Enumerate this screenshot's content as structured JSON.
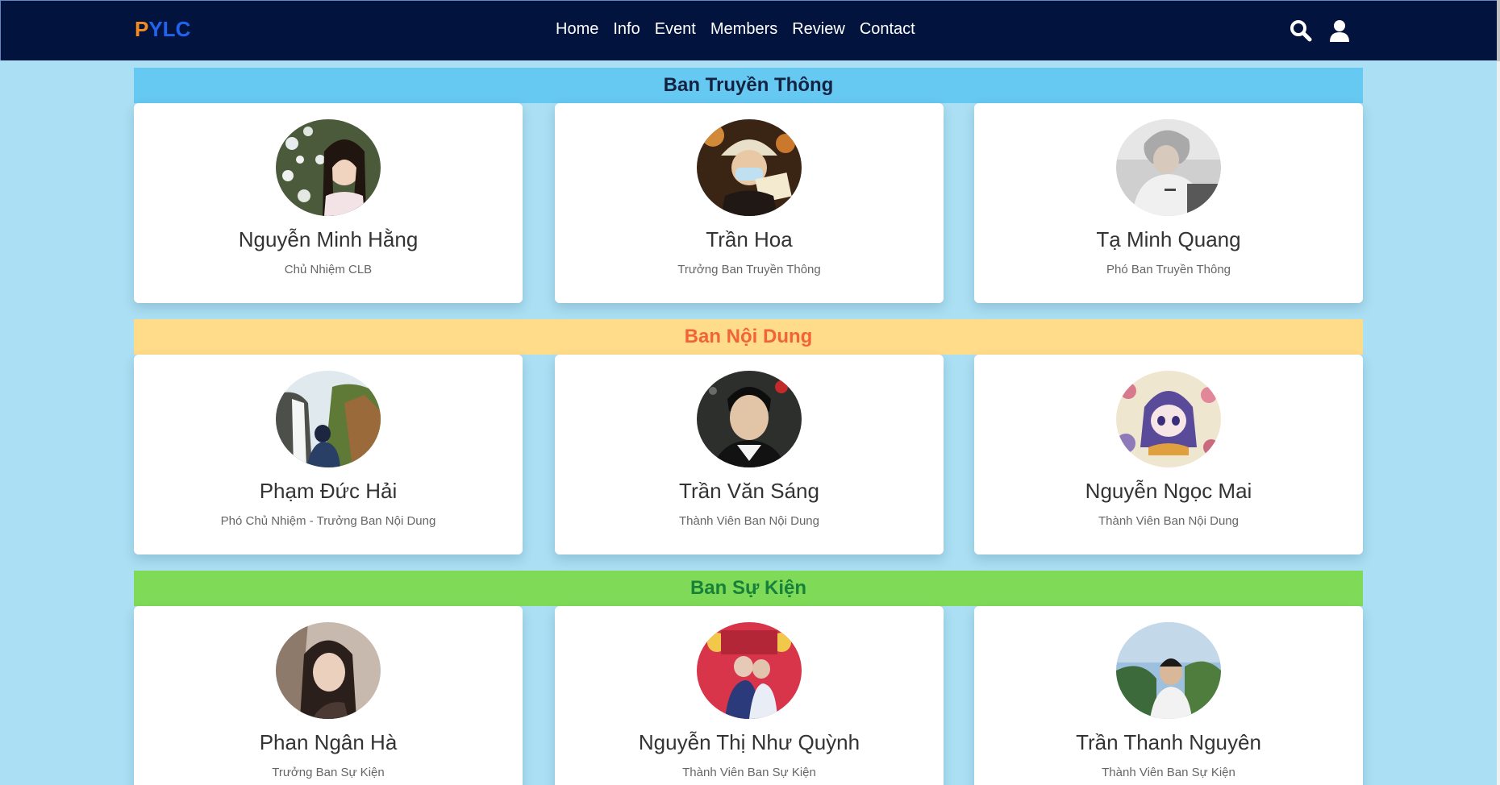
{
  "navbar": {
    "logo_part1": "P",
    "logo_part2": "YLC",
    "links": [
      "Home",
      "Info",
      "Event",
      "Members",
      "Review",
      "Contact"
    ],
    "icons": [
      "search-icon",
      "user-icon"
    ]
  },
  "sections": [
    {
      "title": "Ban Truyền Thông",
      "bg_color": "#66c9f1",
      "title_color": "#152343",
      "members": [
        {
          "name": "Nguyễn Minh Hằng",
          "role": "Chủ Nhiệm CLB"
        },
        {
          "name": "Trần Hoa",
          "role": "Trưởng Ban Truyền Thông"
        },
        {
          "name": "Tạ Minh Quang",
          "role": "Phó Ban Truyền Thông"
        }
      ]
    },
    {
      "title": "Ban Nội Dung",
      "bg_color": "#ffdc8a",
      "title_color": "#f26438",
      "members": [
        {
          "name": "Phạm Đức Hải",
          "role": "Phó Chủ Nhiệm - Trưởng Ban Nội Dung"
        },
        {
          "name": "Trần Văn Sáng",
          "role": "Thành Viên Ban Nội Dung"
        },
        {
          "name": "Nguyễn Ngọc Mai",
          "role": "Thành Viên Ban Nội Dung"
        }
      ]
    },
    {
      "title": "Ban Sự Kiện",
      "bg_color": "#7fdb57",
      "title_color": "#17803b",
      "members": [
        {
          "name": "Phan Ngân Hà",
          "role": "Trưởng Ban Sự Kiện"
        },
        {
          "name": "Nguyễn Thị Như Quỳnh",
          "role": "Thành Viên Ban Sự Kiện"
        },
        {
          "name": "Trần Thanh Nguyên",
          "role": "Thành Viên Ban Sự Kiện"
        }
      ]
    }
  ],
  "colors": {
    "navbar_bg": "#02143d",
    "page_bg": "#abdff3",
    "arrow": "#1a7fe0"
  }
}
